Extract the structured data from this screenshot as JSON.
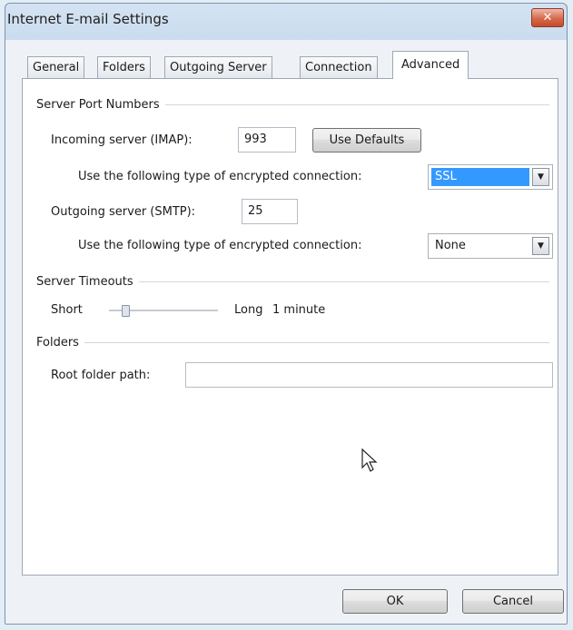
{
  "window": {
    "title": "Internet E-mail Settings",
    "close_glyph": "✕"
  },
  "tabs": [
    {
      "label": "General",
      "active": false
    },
    {
      "label": "Folders",
      "active": false
    },
    {
      "label": "Outgoing Server",
      "active": false
    },
    {
      "label": "Connection",
      "active": false
    },
    {
      "label": "Advanced",
      "active": true
    }
  ],
  "server_ports": {
    "group_label": "Server Port Numbers",
    "incoming_label": "Incoming server (IMAP):",
    "incoming_value": "993",
    "use_defaults_label": "Use Defaults",
    "incoming_enc_label": "Use the following type of encrypted connection:",
    "incoming_enc_value": "SSL",
    "outgoing_label": "Outgoing server (SMTP):",
    "outgoing_value": "25",
    "outgoing_enc_label": "Use the following type of encrypted connection:",
    "outgoing_enc_value": "None"
  },
  "timeouts": {
    "group_label": "Server Timeouts",
    "short_label": "Short",
    "long_label": "Long",
    "value_label": "1 minute",
    "slider_level": 0.1
  },
  "folders": {
    "group_label": "Folders",
    "root_label": "Root folder path:",
    "root_value": ""
  },
  "footer": {
    "ok_label": "OK",
    "cancel_label": "Cancel"
  },
  "icons": {
    "dropdown": "chevron-down-icon",
    "cursor": "mouse-pointer-icon"
  }
}
